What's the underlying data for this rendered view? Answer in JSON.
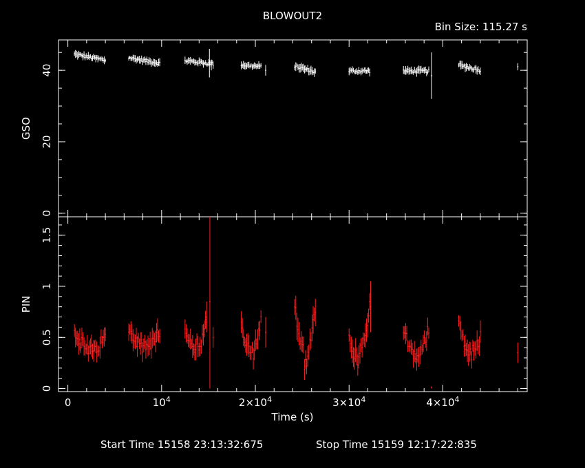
{
  "chart_data": {
    "type": "scatter",
    "title": "BLOWOUT2",
    "subtitle": "Bin Size: 115.27 s",
    "footer": {
      "start_label": "Start Time 15158 23:13:32:675",
      "stop_label": "Stop Time 15159 12:17:22:835"
    },
    "xlabel": "Time (s)",
    "xlim": [
      -1000,
      49000
    ],
    "x_ticks": [
      {
        "value": 0,
        "base": "0",
        "exp": ""
      },
      {
        "value": 10000,
        "base": "10",
        "exp": "4"
      },
      {
        "value": 20000,
        "base": "2×10",
        "exp": "4"
      },
      {
        "value": 30000,
        "base": "3×10",
        "exp": "4"
      },
      {
        "value": 40000,
        "base": "4×10",
        "exp": "4"
      }
    ],
    "panels": [
      {
        "name": "GSO",
        "ylabel": "GSO",
        "color": "#ffffff",
        "ylim": [
          -1,
          48.5
        ],
        "y_ticks": [
          {
            "value": 0,
            "label": "0"
          },
          {
            "value": 20,
            "label": "20"
          },
          {
            "value": 40,
            "label": "40"
          }
        ],
        "segments": [
          {
            "start": 700,
            "end": 4000,
            "y0": 44.5,
            "y1": 42.8,
            "shape": "linear",
            "err": 0.8
          },
          {
            "start": 6500,
            "end": 9800,
            "y0": 43.5,
            "y1": 42.0,
            "shape": "linear",
            "err": 0.8
          },
          {
            "start": 12500,
            "end": 15500,
            "y0": 42.7,
            "y1": 41.8,
            "shape": "linear",
            "err": 0.8
          },
          {
            "start": 18500,
            "end": 20600,
            "y0": 41.5,
            "y1": 41.0,
            "shape": "linear",
            "err": 0.8
          },
          {
            "start": 24200,
            "end": 26400,
            "y0": 41.2,
            "y1": 39.5,
            "shape": "linear",
            "err": 0.9
          },
          {
            "start": 30000,
            "end": 32200,
            "y0": 39.8,
            "y1": 39.8,
            "shape": "linear",
            "err": 0.8
          },
          {
            "start": 35800,
            "end": 38500,
            "y0": 39.8,
            "y1": 39.8,
            "shape": "linear",
            "err": 0.9
          },
          {
            "start": 41700,
            "end": 44000,
            "y0": 41.5,
            "y1": 40.0,
            "shape": "linear",
            "err": 0.9
          }
        ],
        "singles": [
          {
            "x": 15100,
            "y": 42,
            "err": 4
          },
          {
            "x": 15300,
            "y": 41.5,
            "err": 1.5
          },
          {
            "x": 21100,
            "y": 40,
            "err": 1.5
          },
          {
            "x": 38800,
            "y": 38.5,
            "err": 6.5
          },
          {
            "x": 48000,
            "y": 41,
            "err": 1
          }
        ]
      },
      {
        "name": "PIN",
        "ylabel": "PIN",
        "color": "#ff2020",
        "ylim": [
          -0.03,
          1.68
        ],
        "y_ticks": [
          {
            "value": 0,
            "label": "0"
          },
          {
            "value": 0.5,
            "label": "0.5"
          },
          {
            "value": 1,
            "label": "1"
          },
          {
            "value": 1.5,
            "label": "1.5"
          }
        ],
        "segments": [
          {
            "start": 700,
            "end": 4000,
            "y0": 0.55,
            "y1": 0.5,
            "shape": "dip",
            "depth": 0.15,
            "err": 0.08
          },
          {
            "start": 6500,
            "end": 9800,
            "y0": 0.6,
            "y1": 0.55,
            "shape": "dip",
            "depth": 0.15,
            "err": 0.08
          },
          {
            "start": 12500,
            "end": 14800,
            "y0": 0.6,
            "y1": 0.65,
            "shape": "dip",
            "depth": 0.25,
            "err": 0.08
          },
          {
            "start": 18500,
            "end": 20600,
            "y0": 0.6,
            "y1": 0.65,
            "shape": "dip",
            "depth": 0.28,
            "err": 0.08
          },
          {
            "start": 24200,
            "end": 26400,
            "y0": 0.8,
            "y1": 0.8,
            "shape": "dip",
            "depth": 0.5,
            "err": 0.1
          },
          {
            "start": 30000,
            "end": 32200,
            "y0": 0.55,
            "y1": 0.8,
            "shape": "dip",
            "depth": 0.35,
            "err": 0.1
          },
          {
            "start": 35800,
            "end": 38500,
            "y0": 0.6,
            "y1": 0.6,
            "shape": "dip",
            "depth": 0.3,
            "err": 0.08
          },
          {
            "start": 41700,
            "end": 44000,
            "y0": 0.7,
            "y1": 0.5,
            "shape": "dip",
            "depth": 0.25,
            "err": 0.08
          }
        ],
        "singles": [
          {
            "x": 14800,
            "y": 0.7,
            "err": 0.15
          },
          {
            "x": 15150,
            "y": 0.85,
            "err": 0.85
          },
          {
            "x": 15500,
            "y": 0.5,
            "err": 0.1
          },
          {
            "x": 21100,
            "y": 0.55,
            "err": 0.15
          },
          {
            "x": 32300,
            "y": 0.8,
            "err": 0.25
          },
          {
            "x": 38800,
            "y": 0.01,
            "err": 0.01
          },
          {
            "x": 48000,
            "y": 0.35,
            "err": 0.1
          }
        ]
      }
    ]
  }
}
